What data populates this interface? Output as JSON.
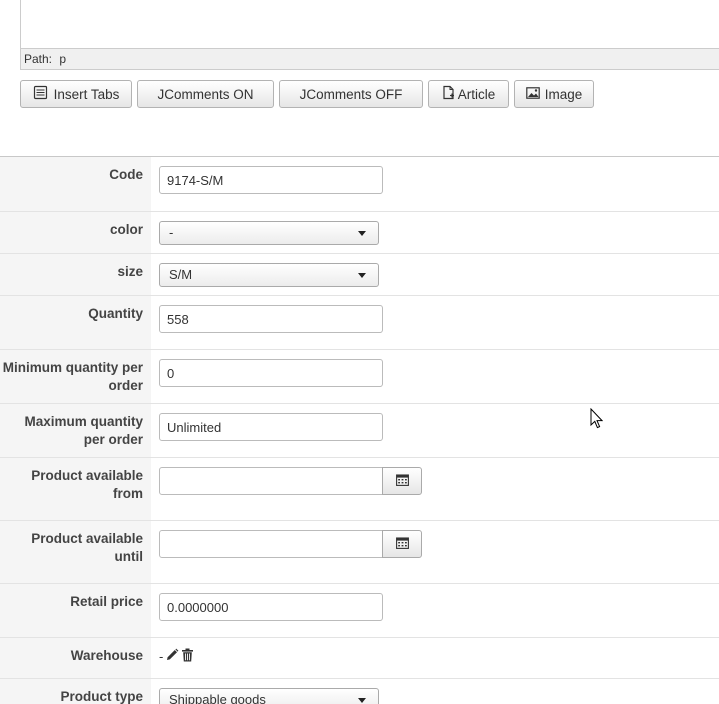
{
  "editor": {
    "path_label": "Path:",
    "path_value": "p"
  },
  "toolbar": {
    "insert_tabs": "Insert Tabs",
    "jcomments_on": "JComments ON",
    "jcomments_off": "JComments OFF",
    "article": "Article",
    "image": "Image"
  },
  "form": {
    "code": {
      "label": "Code",
      "value": "9174-S/M"
    },
    "color": {
      "label": "color",
      "value": "-"
    },
    "size": {
      "label": "size",
      "value": "S/M"
    },
    "quantity": {
      "label": "Quantity",
      "value": "558"
    },
    "min_qty": {
      "label": "Minimum quantity per order",
      "value": "0"
    },
    "max_qty": {
      "label": "Maximum quantity per order",
      "value": "Unlimited"
    },
    "available_from": {
      "label": "Product available from",
      "value": ""
    },
    "available_until": {
      "label": "Product available until",
      "value": ""
    },
    "retail_price": {
      "label": "Retail price",
      "value": "0.0000000"
    },
    "warehouse": {
      "label": "Warehouse",
      "value": "-"
    },
    "product_type": {
      "label": "Product type",
      "value": "Shippable goods"
    }
  },
  "icons": {
    "insert_tabs": "tabs-icon",
    "article": "article-icon",
    "image": "image-icon",
    "calendar": "calendar-icon",
    "edit": "pencil-icon",
    "delete": "trash-icon"
  }
}
